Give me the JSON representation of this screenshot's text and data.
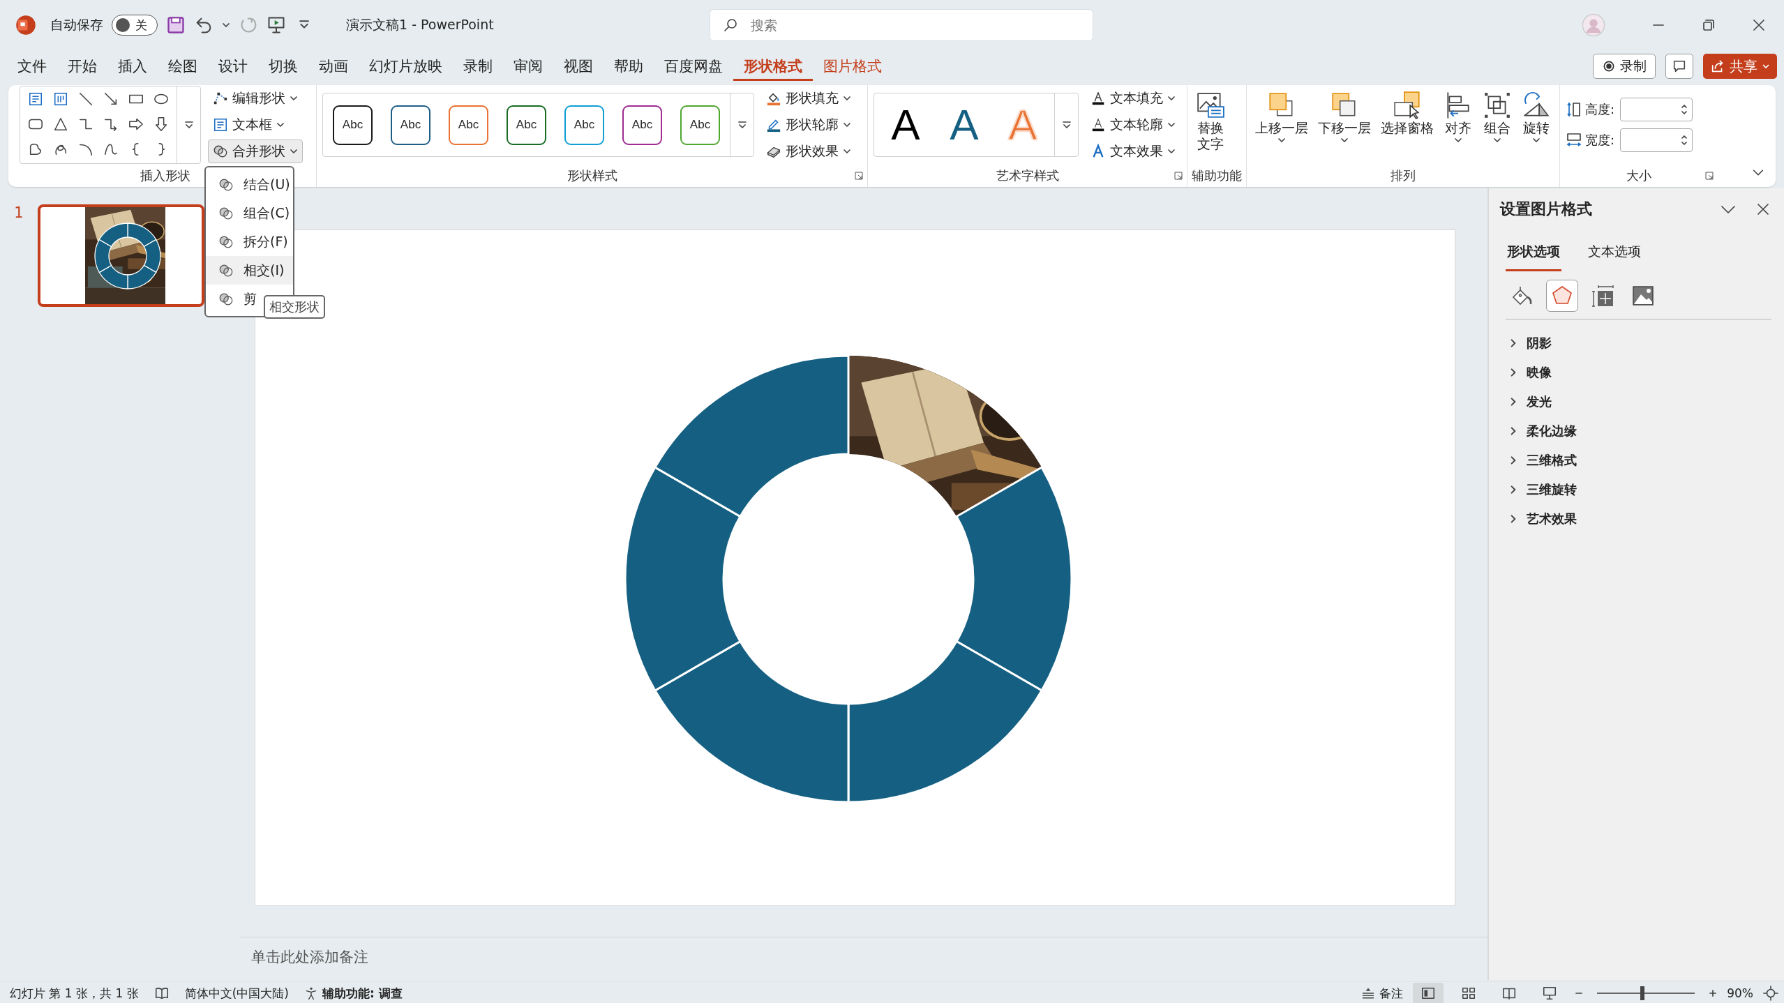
{
  "titlebar": {
    "autosave": {
      "label": "自动保存",
      "on": false,
      "state": "关"
    },
    "document_title": "演示文稿1 - PowerPoint",
    "search": {
      "placeholder": "搜索"
    }
  },
  "menu": {
    "tabs": [
      {
        "label": "文件",
        "selected": false,
        "contextual": false
      },
      {
        "label": "开始",
        "selected": false,
        "contextual": false
      },
      {
        "label": "插入",
        "selected": false,
        "contextual": false
      },
      {
        "label": "绘图",
        "selected": false,
        "contextual": false
      },
      {
        "label": "设计",
        "selected": false,
        "contextual": false
      },
      {
        "label": "切换",
        "selected": false,
        "contextual": false
      },
      {
        "label": "动画",
        "selected": false,
        "contextual": false
      },
      {
        "label": "幻灯片放映",
        "selected": false,
        "contextual": false
      },
      {
        "label": "录制",
        "selected": false,
        "contextual": false
      },
      {
        "label": "审阅",
        "selected": false,
        "contextual": false
      },
      {
        "label": "视图",
        "selected": false,
        "contextual": false
      },
      {
        "label": "帮助",
        "selected": false,
        "contextual": false
      },
      {
        "label": "百度网盘",
        "selected": false,
        "contextual": false
      },
      {
        "label": "形状格式",
        "selected": true,
        "contextual": true
      },
      {
        "label": "图片格式",
        "selected": false,
        "contextual": true
      }
    ],
    "record_button": "录制",
    "share_button": "共享"
  },
  "ribbon": {
    "groups": [
      {
        "kind": "shapes",
        "label": "插入形状",
        "launcher": false,
        "commands": [
          {
            "label": "编辑形状",
            "expanded": false
          },
          {
            "label": "文本框",
            "expanded": false
          },
          {
            "label": "合并形状",
            "expanded": true
          }
        ]
      },
      {
        "kind": "styles",
        "label": "形状样式",
        "launcher": true,
        "styles": [
          {
            "text": "Abc",
            "color": "#1a1a1a"
          },
          {
            "text": "Abc",
            "color": "#1e5e86"
          },
          {
            "text": "Abc",
            "color": "#e97132"
          },
          {
            "text": "Abc",
            "color": "#196b24"
          },
          {
            "text": "Abc",
            "color": "#0f9ed5"
          },
          {
            "text": "Abc",
            "color": "#a02b93"
          },
          {
            "text": "Abc",
            "color": "#4ea72e"
          }
        ],
        "commands": [
          {
            "label": "形状填充"
          },
          {
            "label": "形状轮廓"
          },
          {
            "label": "形状效果"
          }
        ]
      },
      {
        "kind": "wordart",
        "label": "艺术字样式",
        "launcher": true,
        "styles": [
          {
            "text": "A",
            "kind": "solid",
            "color": "#000000"
          },
          {
            "text": "A",
            "kind": "solid",
            "color": "#156082"
          },
          {
            "text": "A",
            "kind": "outlined",
            "color": "#e97132"
          }
        ],
        "commands": [
          {
            "label": "文本填充"
          },
          {
            "label": "文本轮廓"
          },
          {
            "label": "文本效果"
          }
        ]
      },
      {
        "kind": "buttons",
        "label": "辅助功能",
        "launcher": false,
        "buttons": [
          {
            "label": "替换文字",
            "dropdown": false
          }
        ]
      },
      {
        "kind": "buttons",
        "label": "排列",
        "launcher": false,
        "buttons": [
          {
            "label": "上移一层",
            "dropdown": true
          },
          {
            "label": "下移一层",
            "dropdown": true
          },
          {
            "label": "选择窗格",
            "dropdown": false
          },
          {
            "label": "对齐",
            "dropdown": true
          },
          {
            "label": "组合",
            "dropdown": true
          },
          {
            "label": "旋转",
            "dropdown": true
          }
        ]
      },
      {
        "kind": "size",
        "label": "大小",
        "launcher": true,
        "fields": [
          {
            "label": "高度:"
          },
          {
            "label": "宽度:"
          }
        ]
      }
    ]
  },
  "merge_menu": {
    "items": [
      {
        "label": "结合(U)",
        "hovered": false
      },
      {
        "label": "组合(C)",
        "hovered": false
      },
      {
        "label": "拆分(F)",
        "hovered": false
      },
      {
        "label": "相交(I)",
        "hovered": true
      },
      {
        "label": "剪",
        "hovered": false
      }
    ],
    "tooltip": "相交形状"
  },
  "thumbnails": [
    {
      "number": "1",
      "selected": true
    }
  ],
  "slide": {
    "segments": [
      {
        "kind": "picture"
      },
      {
        "kind": "fill"
      },
      {
        "kind": "fill"
      },
      {
        "kind": "fill"
      },
      {
        "kind": "fill"
      },
      {
        "kind": "fill"
      }
    ]
  },
  "notes": {
    "placeholder": "单击此处添加备注"
  },
  "format_pane": {
    "title": "设置图片格式",
    "tabs": [
      {
        "label": "形状选项",
        "selected": true
      },
      {
        "label": "文本选项",
        "selected": false
      }
    ],
    "categories": [
      {
        "selected": false
      },
      {
        "selected": true
      },
      {
        "selected": false
      },
      {
        "selected": false
      }
    ],
    "sections": [
      {
        "label": "阴影",
        "expanded": false
      },
      {
        "label": "映像",
        "expanded": false
      },
      {
        "label": "发光",
        "expanded": false
      },
      {
        "label": "柔化边缘",
        "expanded": false
      },
      {
        "label": "三维格式",
        "expanded": false
      },
      {
        "label": "三维旋转",
        "expanded": false
      },
      {
        "label": "艺术效果",
        "expanded": false
      }
    ]
  },
  "status_bar": {
    "slide_info": "幻灯片 第 1 张，共 1 张",
    "language": "简体中文(中国大陆)",
    "accessibility": "辅助功能: 调查",
    "notes": "备注",
    "views": [
      {
        "selected": true
      },
      {
        "selected": false
      },
      {
        "selected": false
      },
      {
        "selected": false
      }
    ],
    "zoom": {
      "level": 0.46,
      "reading": "90%"
    }
  }
}
